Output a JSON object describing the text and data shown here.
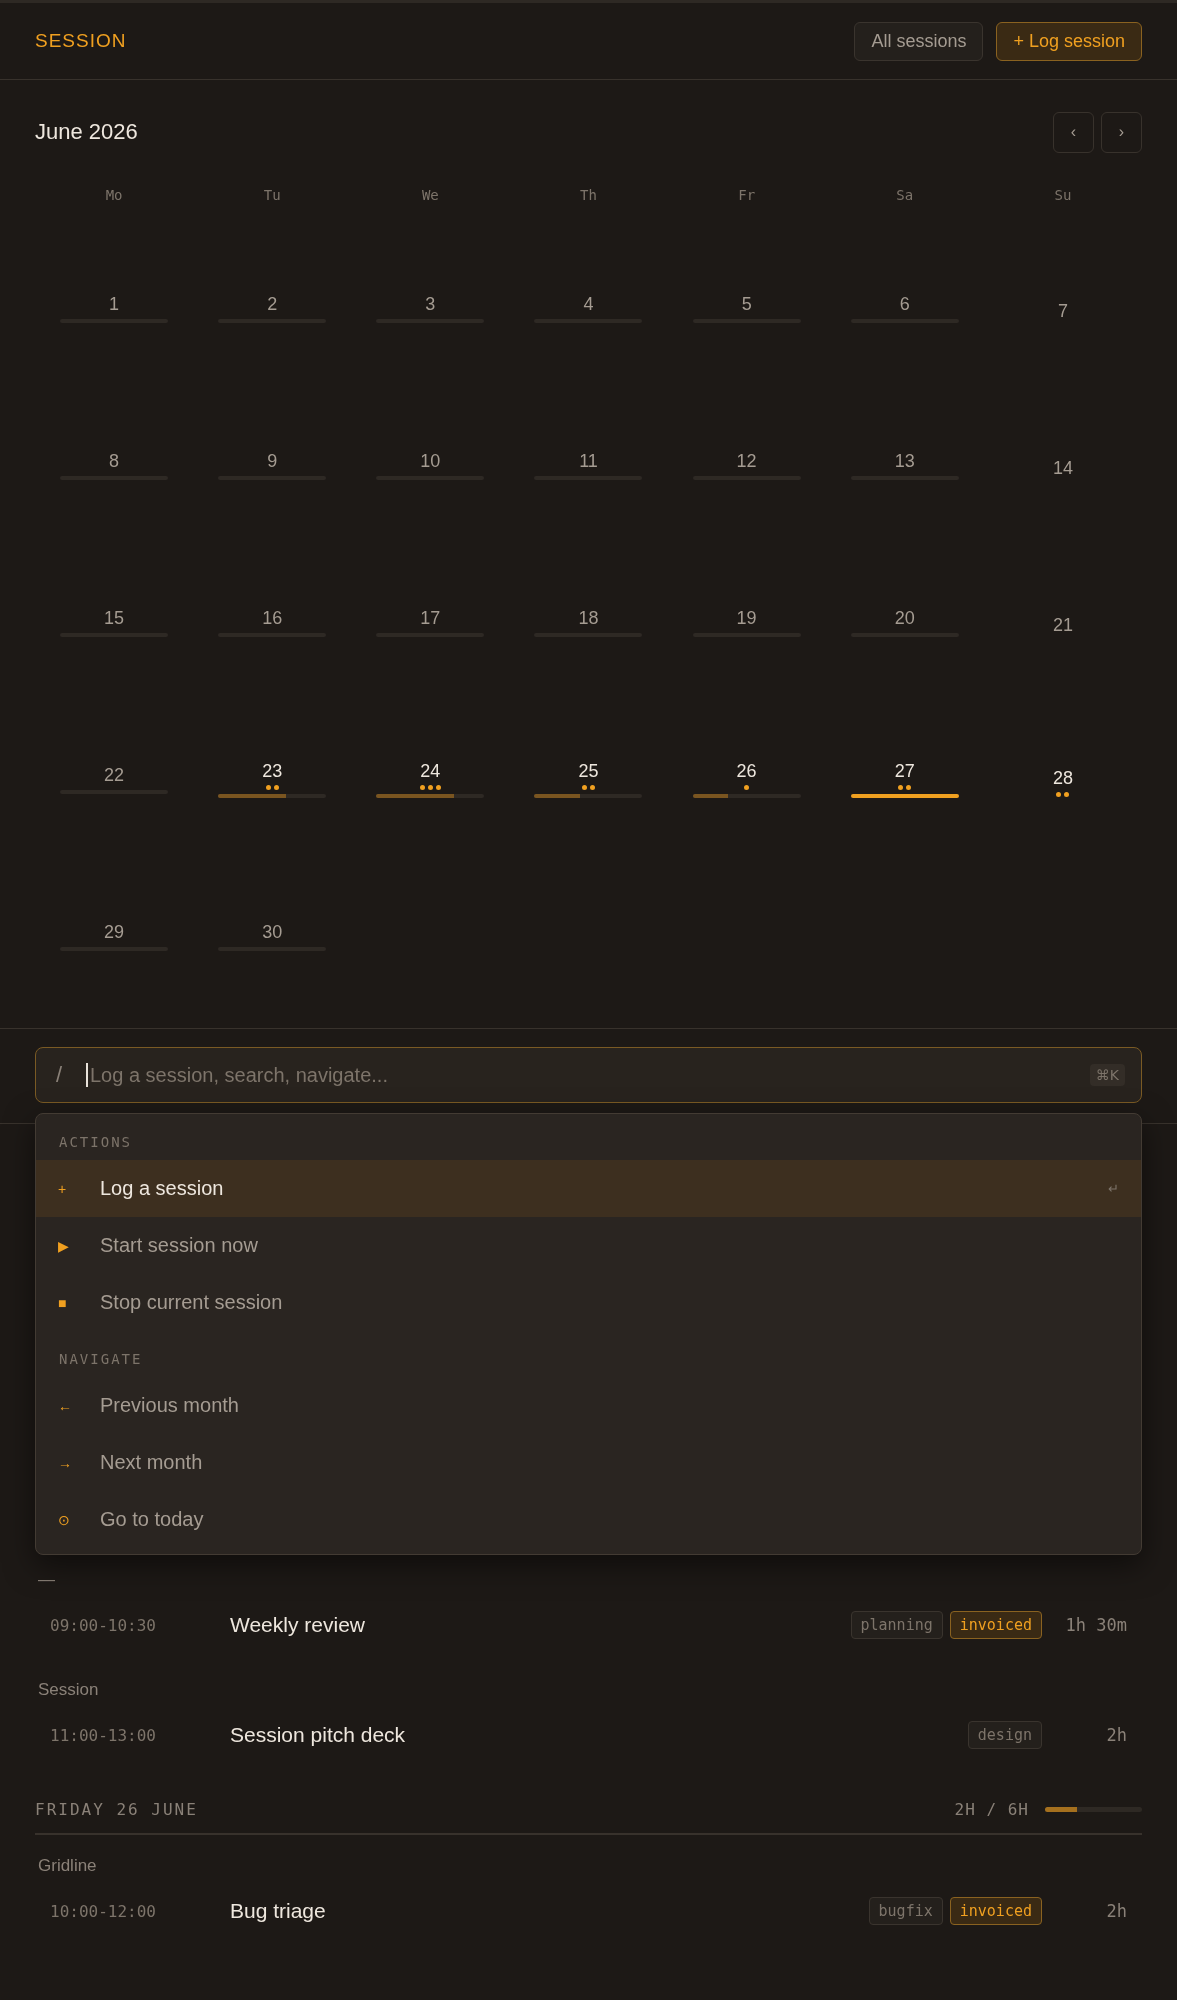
{
  "header": {
    "title": "SESSION",
    "buttons": [
      {
        "label": "All sessions",
        "kind": "secondary"
      },
      {
        "label": "+ Log session",
        "kind": "primary"
      }
    ]
  },
  "calendar": {
    "month": "June 2026",
    "prev": "‹",
    "next": "›",
    "weekdays": [
      "Mo",
      "Tu",
      "We",
      "Th",
      "Fr",
      "Sa",
      "Su"
    ],
    "days": [
      {
        "day": "1",
        "kind": "workday"
      },
      {
        "day": "2",
        "kind": "workday"
      },
      {
        "day": "3",
        "kind": "workday"
      },
      {
        "day": "4",
        "kind": "workday"
      },
      {
        "day": "5",
        "kind": "workday"
      },
      {
        "day": "6",
        "kind": "workday"
      },
      {
        "day": "7",
        "kind": "rest"
      },
      {
        "day": "8",
        "kind": "workday"
      },
      {
        "day": "9",
        "kind": "workday"
      },
      {
        "day": "10",
        "kind": "workday"
      },
      {
        "day": "11",
        "kind": "workday"
      },
      {
        "day": "12",
        "kind": "workday"
      },
      {
        "day": "13",
        "kind": "workday"
      },
      {
        "day": "14",
        "kind": "rest"
      },
      {
        "day": "15",
        "kind": "workday"
      },
      {
        "day": "16",
        "kind": "workday"
      },
      {
        "day": "17",
        "kind": "workday"
      },
      {
        "day": "18",
        "kind": "workday"
      },
      {
        "day": "19",
        "kind": "workday"
      },
      {
        "day": "20",
        "kind": "workday"
      },
      {
        "day": "21",
        "kind": "rest"
      },
      {
        "day": "22",
        "kind": "workday"
      },
      {
        "day": "23",
        "kind": "workday",
        "level": 0.63,
        "dots": [
          {
            "kind": "session"
          },
          {
            "kind": "session"
          }
        ]
      },
      {
        "day": "24",
        "kind": "workday",
        "level": 0.72,
        "dots": [
          {
            "kind": "session"
          },
          {
            "kind": "session"
          },
          {
            "kind": "session"
          }
        ]
      },
      {
        "day": "25",
        "kind": "workday",
        "level": 0.42,
        "dots": [
          {
            "kind": "session"
          },
          {
            "kind": "session"
          }
        ]
      },
      {
        "day": "26",
        "kind": "workday",
        "level": 0.33,
        "dots": [
          {
            "kind": "session"
          }
        ]
      },
      {
        "day": "27",
        "kind": "workday",
        "level": 1,
        "dots": [
          {
            "kind": "session"
          },
          {
            "kind": "session"
          }
        ]
      },
      {
        "day": "28",
        "kind": "rest",
        "dots": [
          {
            "kind": "session"
          },
          {
            "kind": "session"
          }
        ]
      },
      {
        "day": "29",
        "kind": "workday"
      },
      {
        "day": "30",
        "kind": "workday"
      }
    ]
  },
  "command": {
    "prefix": "/",
    "placeholder": "Log a session, search, navigate...",
    "shortcut": "⌘K",
    "groups": [
      {
        "label": "ACTIONS",
        "items": [
          {
            "icon": "+",
            "label": "Log a session",
            "hint": "↵",
            "selected": true
          },
          {
            "icon": "▶",
            "label": "Start session now",
            "selected": false
          },
          {
            "icon": "■",
            "label": "Stop current session",
            "selected": false
          }
        ]
      },
      {
        "label": "NAVIGATE",
        "items": [
          {
            "icon": "←",
            "label": "Previous month",
            "selected": false
          },
          {
            "icon": "→",
            "label": "Next month",
            "selected": false
          },
          {
            "icon": "⊙",
            "label": "Go to today",
            "selected": false
          }
        ]
      }
    ]
  },
  "sessions": [
    {
      "kind": "group",
      "label": "—"
    },
    {
      "kind": "entry",
      "time": "09:00-10:30",
      "title": "Weekly review",
      "tags": [
        {
          "label": "planning",
          "invoiced": false
        },
        {
          "label": "invoiced",
          "invoiced": true
        }
      ],
      "duration": "1h 30m"
    },
    {
      "kind": "group",
      "label": "Session"
    },
    {
      "kind": "entry",
      "time": "11:00-13:00",
      "title": "Session pitch deck",
      "tags": [
        {
          "label": "design",
          "invoiced": false
        }
      ],
      "duration": "2h"
    },
    {
      "kind": "day",
      "label": "FRIDAY 26 JUNE",
      "total": "2H / 6H",
      "level": 0.33
    },
    {
      "kind": "group",
      "label": "Gridline"
    },
    {
      "kind": "entry",
      "time": "10:00-12:00",
      "title": "Bug triage",
      "tags": [
        {
          "label": "bugfix",
          "invoiced": false
        },
        {
          "label": "invoiced",
          "invoiced": true
        }
      ],
      "duration": "2h"
    }
  ]
}
